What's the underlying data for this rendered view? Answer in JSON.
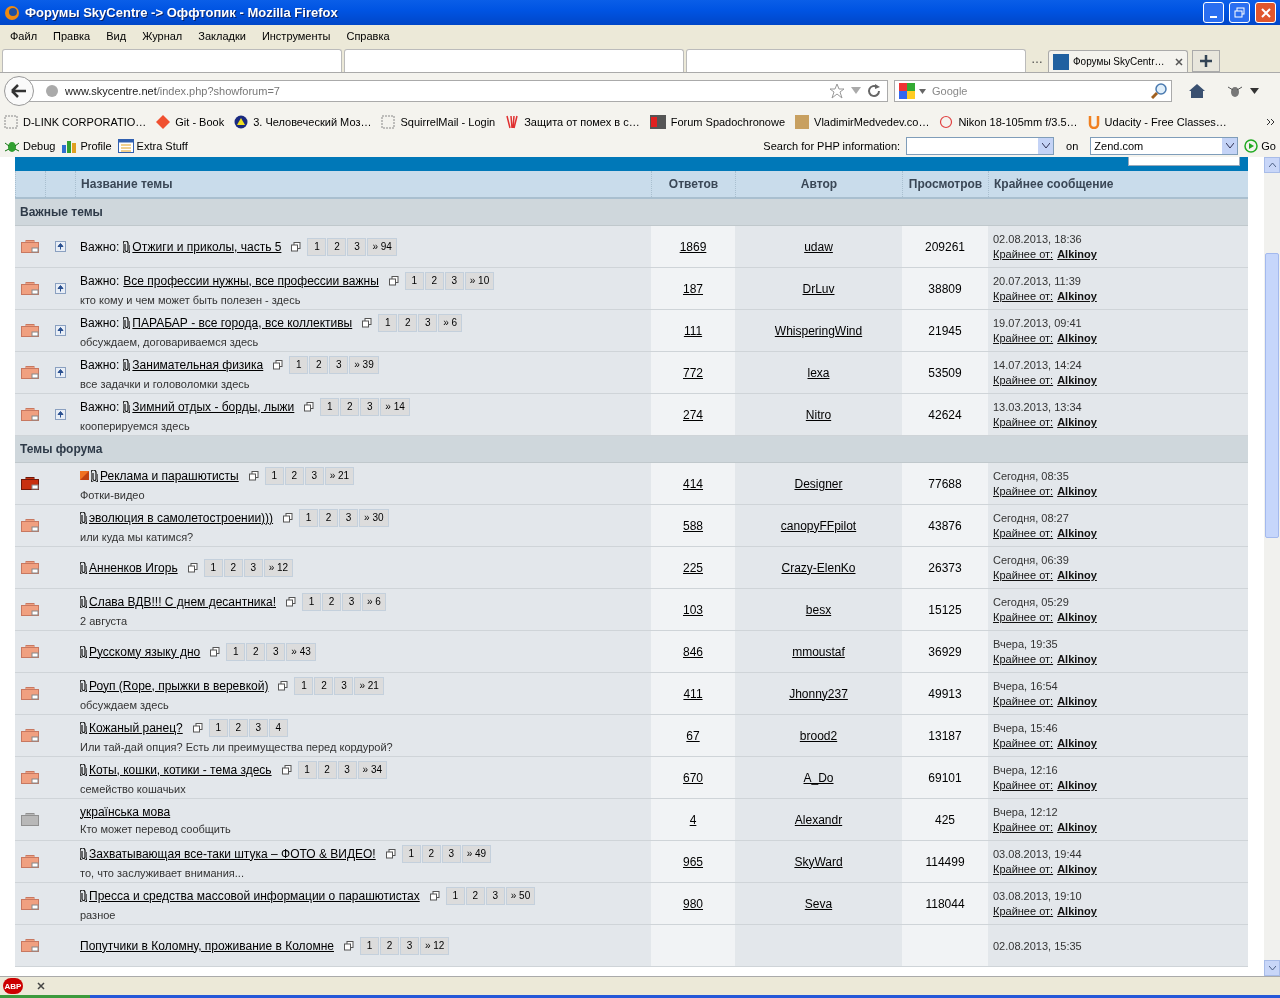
{
  "window": {
    "title": "Форумы SkyCentre -> Оффтопик - Mozilla Firefox"
  },
  "menu": [
    "Файл",
    "Правка",
    "Вид",
    "Журнал",
    "Закладки",
    "Инструменты",
    "Справка"
  ],
  "tab_strip": {
    "overflow_mark": "…",
    "tabs": [
      {
        "label": "Форумы SkyCentr…",
        "selected": true
      }
    ]
  },
  "nav": {
    "url_host": "www.skycentre.net",
    "url_path": "/index.php?showforum=7",
    "search_placeholder": "Google"
  },
  "bookmarks": [
    {
      "label": "D-LINK CORPORATIO…",
      "kind": "blank"
    },
    {
      "label": "Git - Book",
      "kind": "git"
    },
    {
      "label": "3. Человеческий Моз…",
      "kind": "badge"
    },
    {
      "label": "SquirrelMail - Login",
      "kind": "blank"
    },
    {
      "label": "Защита от помех в с…",
      "kind": "bars"
    },
    {
      "label": "Forum Spadochronowe",
      "kind": "fs"
    },
    {
      "label": "VladimirMedvedev.co…",
      "kind": "photo"
    },
    {
      "label": "Nikon 18-105mm f/3.5…",
      "kind": "ring"
    },
    {
      "label": "Udacity - Free Classes…",
      "kind": "u"
    }
  ],
  "dev_toolbar": {
    "items": [
      {
        "label": "Debug",
        "kind": "bug"
      },
      {
        "label": "Profile",
        "kind": "chart"
      },
      {
        "label": "Extra Stuff",
        "kind": "calendar"
      }
    ],
    "search_label": "Search for PHP information:",
    "on_label": "on",
    "site_value": "Zend.com",
    "go_label": "Go"
  },
  "forum": {
    "columns": [
      "Название темы",
      "Ответов",
      "Автор",
      "Просмотров",
      "Крайнее сообщение"
    ],
    "sections": [
      {
        "title": "Важные темы",
        "rows": [
          {
            "hot": false,
            "dimmed": false,
            "pinned": true,
            "prefix": "Важно:",
            "new_mark": false,
            "attachment": true,
            "title": "Отжиги и приколы, часть 5",
            "pages": [
              "1",
              "2",
              "3",
              "» 94"
            ],
            "replies": "1869",
            "author": "udaw",
            "views": "209261",
            "date": "02.08.2013, 18:36",
            "last_by_label": "Крайнее от:",
            "last_by": "Alkinoy"
          },
          {
            "hot": false,
            "dimmed": false,
            "pinned": true,
            "prefix": "Важно:",
            "new_mark": false,
            "attachment": false,
            "title": "Все профессии нужны, все профессии важны",
            "pages": [
              "1",
              "2",
              "3",
              "» 10"
            ],
            "description": "кто кому и чем может быть полезен - здесь",
            "replies": "187",
            "author": "DrLuv",
            "views": "38809",
            "date": "20.07.2013, 11:39",
            "last_by_label": "Крайнее от:",
            "last_by": "Alkinoy"
          },
          {
            "hot": false,
            "dimmed": false,
            "pinned": true,
            "prefix": "Важно:",
            "new_mark": false,
            "attachment": true,
            "title": "ПАРАБАР - все города, все коллективы",
            "pages": [
              "1",
              "2",
              "3",
              "» 6"
            ],
            "description": "обсуждаем, договариваемся здесь",
            "replies": "111",
            "author": "WhisperingWind",
            "views": "21945",
            "date": "19.07.2013, 09:41",
            "last_by_label": "Крайнее от:",
            "last_by": "Alkinoy"
          },
          {
            "hot": false,
            "dimmed": false,
            "pinned": true,
            "prefix": "Важно:",
            "new_mark": false,
            "attachment": true,
            "title": "Занимательная физика",
            "pages": [
              "1",
              "2",
              "3",
              "» 39"
            ],
            "description": "все задачки и головоломки здесь",
            "replies": "772",
            "author": "lexa",
            "views": "53509",
            "date": "14.07.2013, 14:24",
            "last_by_label": "Крайнее от:",
            "last_by": "Alkinoy"
          },
          {
            "hot": false,
            "dimmed": false,
            "pinned": true,
            "prefix": "Важно:",
            "new_mark": false,
            "attachment": true,
            "title": "Зимний отдых - борды, лыжи",
            "pages": [
              "1",
              "2",
              "3",
              "» 14"
            ],
            "description": "кооперируемся здесь",
            "replies": "274",
            "author": "Nitro",
            "views": "42624",
            "date": "13.03.2013, 13:34",
            "last_by_label": "Крайнее от:",
            "last_by": "Alkinoy"
          }
        ]
      },
      {
        "title": "Темы форума",
        "rows": [
          {
            "hot": true,
            "dimmed": false,
            "pinned": false,
            "new_mark": true,
            "attachment": true,
            "title": "Реклама и парашютисты",
            "pages": [
              "1",
              "2",
              "3",
              "» 21"
            ],
            "description": "Фотки-видео",
            "replies": "414",
            "author": "Designer",
            "views": "77688",
            "date": "Сегодня, 08:35",
            "last_by_label": "Крайнее от:",
            "last_by": "Alkinoy"
          },
          {
            "hot": false,
            "dimmed": false,
            "pinned": false,
            "new_mark": false,
            "attachment": true,
            "title": "эволюция в самолетостроении)))",
            "pages": [
              "1",
              "2",
              "3",
              "» 30"
            ],
            "description": "или куда мы катимся?",
            "replies": "588",
            "author": "canopyFFpilot",
            "views": "43876",
            "date": "Сегодня, 08:27",
            "last_by_label": "Крайнее от:",
            "last_by": "Alkinoy"
          },
          {
            "hot": false,
            "dimmed": false,
            "pinned": false,
            "new_mark": false,
            "attachment": true,
            "title": "Анненков Игорь",
            "pages": [
              "1",
              "2",
              "3",
              "» 12"
            ],
            "replies": "225",
            "author": "Crazy-ElenKo",
            "views": "26373",
            "date": "Сегодня, 06:39",
            "last_by_label": "Крайнее от:",
            "last_by": "Alkinoy"
          },
          {
            "hot": false,
            "dimmed": false,
            "pinned": false,
            "new_mark": false,
            "attachment": true,
            "title": "Слава ВДВ!!! С днем десантника!",
            "pages": [
              "1",
              "2",
              "3",
              "» 6"
            ],
            "description": "2 августа",
            "replies": "103",
            "author": "besx",
            "views": "15125",
            "date": "Сегодня, 05:29",
            "last_by_label": "Крайнее от:",
            "last_by": "Alkinoy"
          },
          {
            "hot": false,
            "dimmed": false,
            "pinned": false,
            "new_mark": false,
            "attachment": true,
            "title": "Русскому языку дно",
            "pages": [
              "1",
              "2",
              "3",
              "» 43"
            ],
            "replies": "846",
            "author": "mmoustaf",
            "views": "36929",
            "date": "Вчера, 19:35",
            "last_by_label": "Крайнее от:",
            "last_by": "Alkinoy"
          },
          {
            "hot": false,
            "dimmed": false,
            "pinned": false,
            "new_mark": false,
            "attachment": true,
            "title": "Роуп (Rope, прыжки в веревкой)",
            "pages": [
              "1",
              "2",
              "3",
              "» 21"
            ],
            "description": "обсуждаем здесь",
            "replies": "411",
            "author": "Jhonny237",
            "views": "49913",
            "date": "Вчера, 16:54",
            "last_by_label": "Крайнее от:",
            "last_by": "Alkinoy"
          },
          {
            "hot": false,
            "dimmed": false,
            "pinned": false,
            "new_mark": false,
            "attachment": true,
            "title": "Кожаный ранец?",
            "pages": [
              "1",
              "2",
              "3",
              "4"
            ],
            "description": "Или тай-дай опция? Есть ли преимущества перед кордурой?",
            "replies": "67",
            "author": "brood2",
            "views": "13187",
            "date": "Вчера, 15:46",
            "last_by_label": "Крайнее от:",
            "last_by": "Alkinoy"
          },
          {
            "hot": false,
            "dimmed": false,
            "pinned": false,
            "new_mark": false,
            "attachment": true,
            "title": "Коты, кошки, котики - тема здесь",
            "pages": [
              "1",
              "2",
              "3",
              "» 34"
            ],
            "description": "семейство кошачьих",
            "replies": "670",
            "author": "A_Do",
            "views": "69101",
            "date": "Вчера, 12:16",
            "last_by_label": "Крайнее от:",
            "last_by": "Alkinoy"
          },
          {
            "hot": false,
            "dimmed": true,
            "pinned": false,
            "new_mark": false,
            "attachment": false,
            "title": "українська мова",
            "description": "Кто может перевод сообщить",
            "replies": "4",
            "author": "Alexandr",
            "views": "425",
            "date": "Вчера, 12:12",
            "last_by_label": "Крайнее от:",
            "last_by": "Alkinoy"
          },
          {
            "hot": false,
            "dimmed": false,
            "pinned": false,
            "new_mark": false,
            "attachment": true,
            "title": "Захватывающая все-таки штука – ФОТО & ВИДЕО!",
            "pages": [
              "1",
              "2",
              "3",
              "» 49"
            ],
            "description": "то, что заслуживает внимания...",
            "replies": "965",
            "author": "SkyWard",
            "views": "114499",
            "date": "03.08.2013, 19:44",
            "last_by_label": "Крайнее от:",
            "last_by": "Alkinoy"
          },
          {
            "hot": false,
            "dimmed": false,
            "pinned": false,
            "new_mark": false,
            "attachment": true,
            "title": "Пресса и средства массовой информации о парашютистах",
            "pages": [
              "1",
              "2",
              "3",
              "» 50"
            ],
            "description": "разное",
            "replies": "980",
            "author": "Seva",
            "views": "118044",
            "date": "03.08.2013, 19:10",
            "last_by_label": "Крайнее от:",
            "last_by": "Alkinoy"
          },
          {
            "hot": false,
            "dimmed": false,
            "pinned": false,
            "new_mark": false,
            "attachment": false,
            "title": "Попутчики в Коломну, проживание в Коломне",
            "pages": [
              "1",
              "2",
              "3",
              "» 12"
            ],
            "date": "02.08.2013, 15:35"
          }
        ]
      }
    ]
  },
  "status_bar": {
    "adblock_label": "ABP"
  }
}
